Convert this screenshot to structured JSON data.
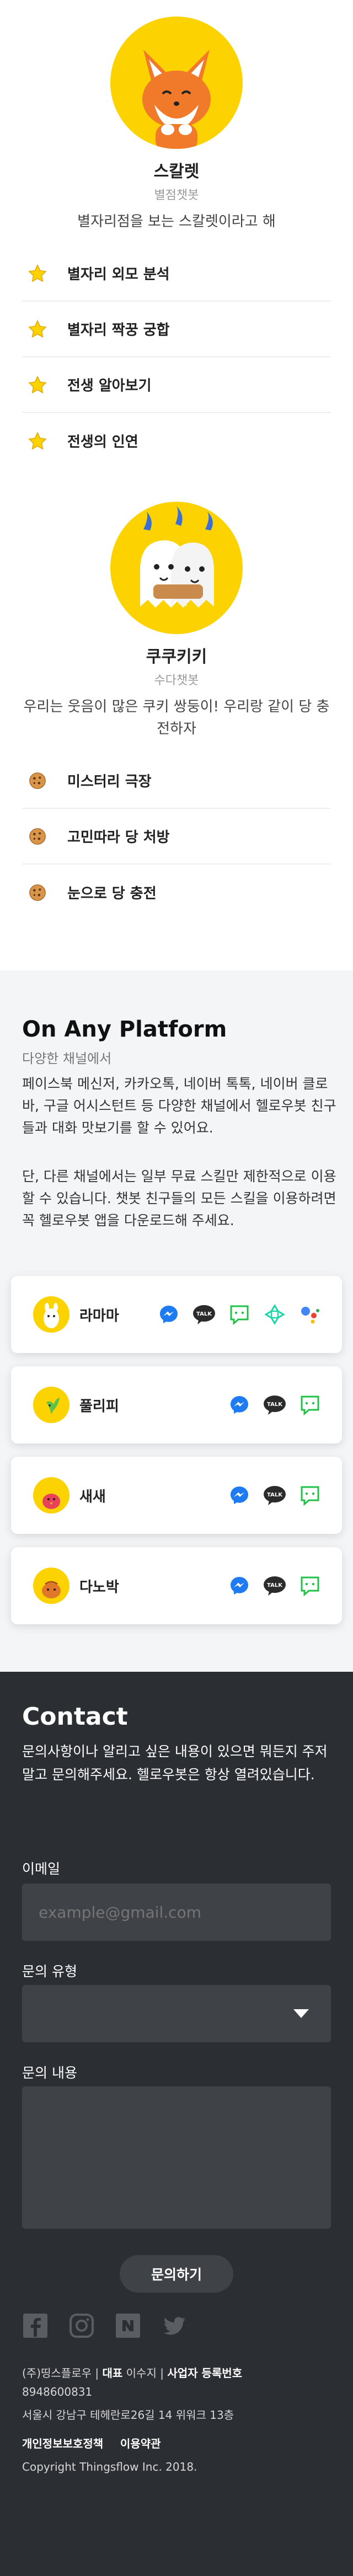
{
  "bots": [
    {
      "name": "스칼렛",
      "subtitle": "별점챗봇",
      "description": "별자리점을 보는 스칼렛이라고 해",
      "skills": [
        {
          "label": "별자리 외모 분석",
          "icon": "star-icon"
        },
        {
          "label": "별자리 짝꿍 궁합",
          "icon": "star-icon"
        },
        {
          "label": "전생 알아보기",
          "icon": "star-icon"
        },
        {
          "label": "전생의 인연",
          "icon": "star-icon"
        }
      ]
    },
    {
      "name": "쿠쿠키키",
      "subtitle": "수다챗봇",
      "description": "우리는 웃음이 많은 쿠키 쌍둥이! 우리랑 같이 당 충전하자",
      "skills": [
        {
          "label": "미스터리 극장",
          "icon": "cookie-icon"
        },
        {
          "label": "고민따라 당 처방",
          "icon": "cookie-icon"
        },
        {
          "label": "눈으로 당 충전",
          "icon": "cookie-icon"
        }
      ]
    }
  ],
  "platform": {
    "title": "On Any Platform",
    "subtitle": "다양한 채널에서",
    "paragraph1": "페이스북 메신저, 카카오톡, 네이버 톡톡, 네이버 클로바, 구글 어시스턴트 등 다양한 채널에서 헬로우봇 친구들과 대화 맛보기를 할 수 있어요.",
    "paragraph2": "단, 다른 채널에서는 일부 무료 스킬만 제한적으로 이용할 수 있습니다. 챗봇 친구들의 모든 스킬을 이용하려면 꼭 헬로우봇 앱을 다운로드해 주세요.",
    "bots": [
      {
        "name": "라마마",
        "channels": [
          "messenger-icon",
          "kakaotalk-icon",
          "naver-talktalk-icon",
          "clova-icon",
          "google-assistant-icon"
        ]
      },
      {
        "name": "풀리피",
        "channels": [
          "messenger-icon",
          "kakaotalk-icon",
          "naver-talktalk-icon"
        ]
      },
      {
        "name": "새새",
        "channels": [
          "messenger-icon",
          "kakaotalk-icon",
          "naver-talktalk-icon"
        ]
      },
      {
        "name": "다노박",
        "channels": [
          "messenger-icon",
          "kakaotalk-icon",
          "naver-talktalk-icon"
        ]
      }
    ]
  },
  "contact": {
    "title": "Contact",
    "description": "문의사항이나 알리고 싶은 내용이 있으면 뭐든지 주저말고 문의해주세요. 헬로우봇은 항상 열려있습니다.",
    "email_label": "이메일",
    "email_placeholder": "example@gmail.com",
    "type_label": "문의 유형",
    "type_value": "",
    "content_label": "문의 내용",
    "submit_label": "문의하기"
  },
  "footer": {
    "social": [
      "facebook-icon",
      "instagram-icon",
      "naver-blog-icon",
      "twitter-icon"
    ],
    "company": "(주)띵스플로우",
    "ceo_label": "대표",
    "ceo_name": "이수지",
    "reg_label": "사업자 등록번호",
    "reg_number": "8948600831",
    "address": "서울시 강남구 테헤란로26길 14 위워크 13층",
    "privacy_link": "개인정보보호정책",
    "terms_link": "이용약관",
    "copyright": "Copyright Thingsflow Inc. 2018."
  },
  "colors": {
    "accent": "#fcd300",
    "platform_bg": "#f4f5f7",
    "contact_bg": "#2b2e33",
    "field_bg": "#3f4247"
  }
}
